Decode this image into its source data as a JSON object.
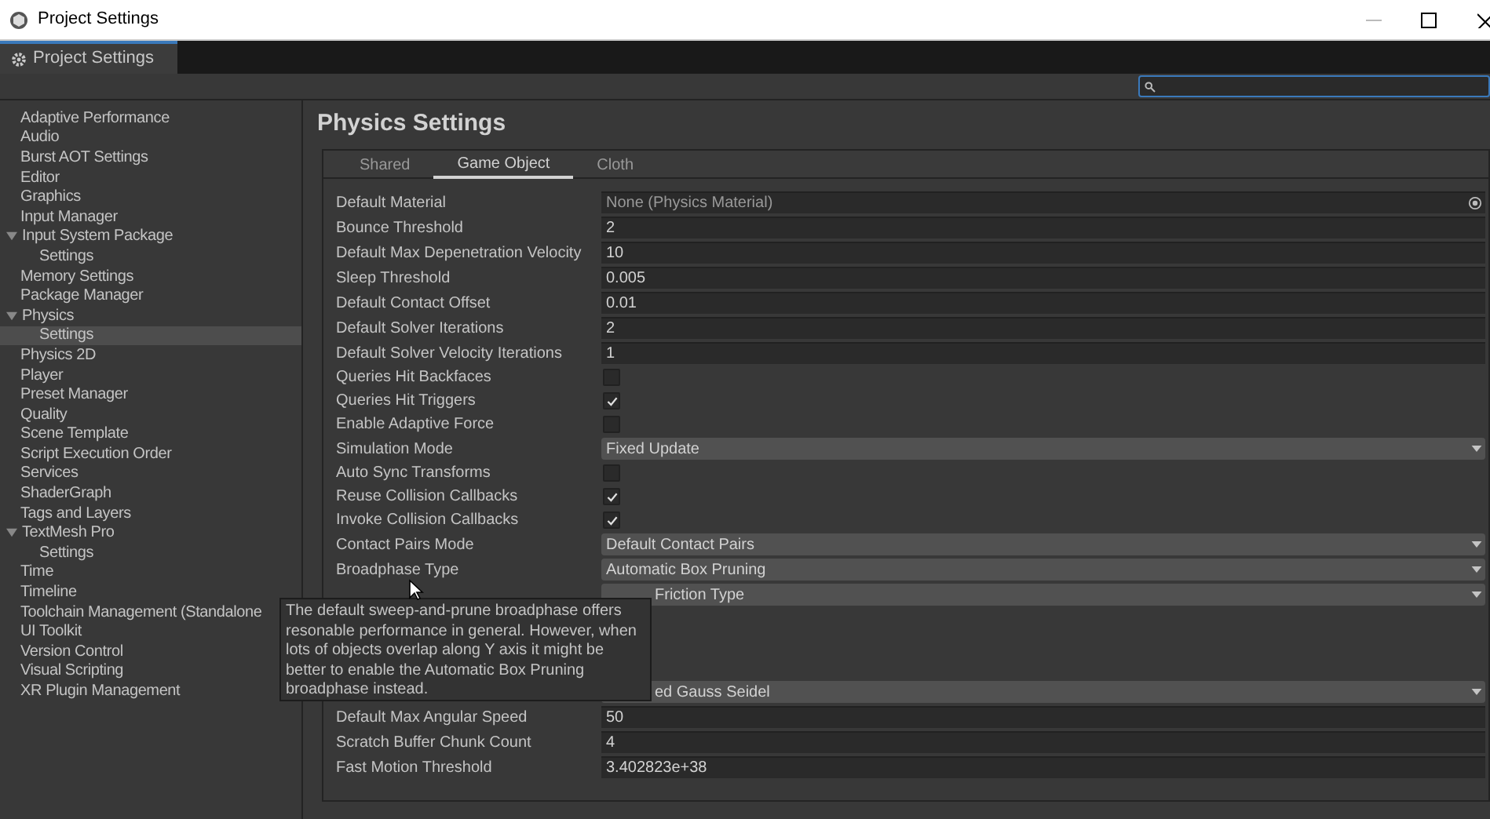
{
  "window": {
    "title": "Project Settings"
  },
  "editor_tab": {
    "label": "Project Settings",
    "selected": true
  },
  "sidebar": {
    "items": [
      {
        "label": "Adaptive Performance",
        "selected": false
      },
      {
        "label": "Audio",
        "selected": false
      },
      {
        "label": "Burst AOT Settings",
        "selected": false
      },
      {
        "label": "Editor",
        "selected": false
      },
      {
        "label": "Graphics",
        "selected": false
      },
      {
        "label": "Input Manager",
        "selected": false
      },
      {
        "label": "Input System Package",
        "selected": false,
        "expanded": true,
        "children": [
          {
            "label": "Settings",
            "selected": false
          }
        ]
      },
      {
        "label": "Memory Settings",
        "selected": false
      },
      {
        "label": "Package Manager",
        "selected": false
      },
      {
        "label": "Physics",
        "selected": false,
        "expanded": true,
        "children": [
          {
            "label": "Settings",
            "selected": true
          }
        ]
      },
      {
        "label": "Physics 2D",
        "selected": false
      },
      {
        "label": "Player",
        "selected": false
      },
      {
        "label": "Preset Manager",
        "selected": false
      },
      {
        "label": "Quality",
        "selected": false
      },
      {
        "label": "Scene Template",
        "selected": false
      },
      {
        "label": "Script Execution Order",
        "selected": false
      },
      {
        "label": "Services",
        "selected": false
      },
      {
        "label": "ShaderGraph",
        "selected": false
      },
      {
        "label": "Tags and Layers",
        "selected": false
      },
      {
        "label": "TextMesh Pro",
        "selected": false,
        "expanded": true,
        "children": [
          {
            "label": "Settings",
            "selected": false
          }
        ]
      },
      {
        "label": "Time",
        "selected": false
      },
      {
        "label": "Timeline",
        "selected": false
      },
      {
        "label": "Toolchain Management (Standalone",
        "selected": false
      },
      {
        "label": "UI Toolkit",
        "selected": false
      },
      {
        "label": "Version Control",
        "selected": false
      },
      {
        "label": "Visual Scripting",
        "selected": false
      },
      {
        "label": "XR Plugin Management",
        "selected": false
      }
    ]
  },
  "page": {
    "title": "Physics Settings",
    "tabs": [
      {
        "label": "Shared",
        "selected": false
      },
      {
        "label": "Game Object",
        "selected": true
      },
      {
        "label": "Cloth",
        "selected": false
      }
    ],
    "rows": [
      {
        "kind": "object",
        "label": "Default Material",
        "value": "None (Physics Material)"
      },
      {
        "kind": "field",
        "label": "Bounce Threshold",
        "value": "2"
      },
      {
        "kind": "field",
        "label": "Default Max Depenetration Velocity",
        "value": "10"
      },
      {
        "kind": "field",
        "label": "Sleep Threshold",
        "value": "0.005"
      },
      {
        "kind": "field",
        "label": "Default Contact Offset",
        "value": "0.01"
      },
      {
        "kind": "field",
        "label": "Default Solver Iterations",
        "value": "2"
      },
      {
        "kind": "field",
        "label": "Default Solver Velocity Iterations",
        "value": "1"
      },
      {
        "kind": "checkbox",
        "label": "Queries Hit Backfaces",
        "checked": false
      },
      {
        "kind": "checkbox",
        "label": "Queries Hit Triggers",
        "checked": true
      },
      {
        "kind": "checkbox",
        "label": "Enable Adaptive Force",
        "checked": false
      },
      {
        "kind": "dropdown",
        "label": "Simulation Mode",
        "value": "Fixed Update"
      },
      {
        "kind": "checkbox",
        "label": "Auto Sync Transforms",
        "checked": false
      },
      {
        "kind": "checkbox",
        "label": "Reuse Collision Callbacks",
        "checked": true
      },
      {
        "kind": "checkbox",
        "label": "Invoke Collision Callbacks",
        "checked": true
      },
      {
        "kind": "dropdown",
        "label": "Contact Pairs Mode",
        "value": "Default Contact Pairs"
      },
      {
        "kind": "dropdown",
        "label": "Broadphase Type",
        "value": "Automatic Box Pruning"
      },
      {
        "kind": "covered",
        "value": "Friction Type"
      },
      {
        "kind": "covered",
        "value": "ed Gauss Seidel"
      },
      {
        "kind": "field",
        "label": "Default Max Angular Speed",
        "value": "50"
      },
      {
        "kind": "field",
        "label": "Scratch Buffer Chunk Count",
        "value": "4"
      },
      {
        "kind": "field",
        "label": "Fast Motion Threshold",
        "value": "3.402823e+38"
      }
    ]
  },
  "tooltip": {
    "text": "The default sweep-and-prune broadphase offers resonable performance in general. However, when lots of objects overlap along Y axis it might be better to enable the Automatic Box Pruning broadphase instead."
  }
}
